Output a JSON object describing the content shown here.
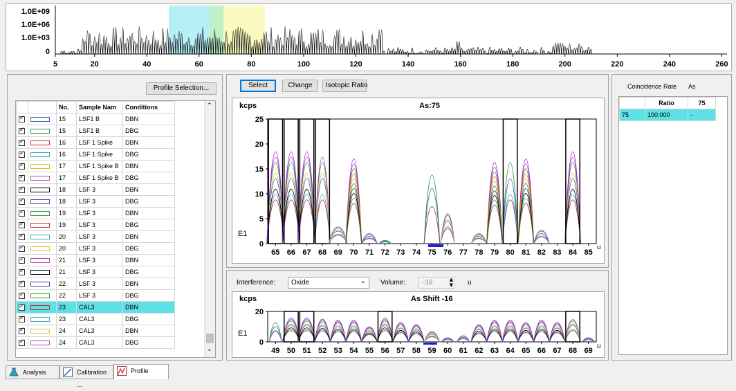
{
  "overview": {
    "y_ticks": [
      "1.0E+09",
      "1.0E+06",
      "1.0E+03",
      "0"
    ],
    "x_ticks": [
      "5",
      "20",
      "40",
      "60",
      "80",
      "100",
      "120",
      "140",
      "160",
      "180",
      "200",
      "220",
      "240",
      "260"
    ]
  },
  "left_panel": {
    "profile_selection_label": "Profile Selection...",
    "columns": [
      "No.",
      "Sample Nam",
      "Conditions"
    ],
    "rows": [
      {
        "no": "15",
        "sample": "LSF1 B",
        "cond": "DBN",
        "color": "#3c63c4",
        "selected": false
      },
      {
        "no": "15",
        "sample": "LSF1 B",
        "cond": "DBG",
        "color": "#2e9a3a",
        "selected": false
      },
      {
        "no": "16",
        "sample": "LSF 1 Spike",
        "cond": "DBN",
        "color": "#c43232",
        "selected": false
      },
      {
        "no": "16",
        "sample": "LSF 1 Spike",
        "cond": "DBG",
        "color": "#32aac8",
        "selected": false
      },
      {
        "no": "17",
        "sample": "LSF 1 Spike B",
        "cond": "DBN",
        "color": "#e0c030",
        "selected": false
      },
      {
        "no": "17",
        "sample": "LSF 1 Spike B",
        "cond": "DBG",
        "color": "#c040c0",
        "selected": false
      },
      {
        "no": "18",
        "sample": "LSF 3",
        "cond": "DBN",
        "color": "#000000",
        "selected": false
      },
      {
        "no": "18",
        "sample": "LSF 3",
        "cond": "DBG",
        "color": "#3c3cb4",
        "selected": false
      },
      {
        "no": "19",
        "sample": "LSF 3",
        "cond": "DBN",
        "color": "#2e9a3a",
        "selected": false
      },
      {
        "no": "19",
        "sample": "LSF 3",
        "cond": "DBG",
        "color": "#c43232",
        "selected": false
      },
      {
        "no": "20",
        "sample": "LSF 3",
        "cond": "DBN",
        "color": "#32aac8",
        "selected": false
      },
      {
        "no": "20",
        "sample": "LSF 3",
        "cond": "DBG",
        "color": "#e0c030",
        "selected": false
      },
      {
        "no": "21",
        "sample": "LSF 3",
        "cond": "DBN",
        "color": "#c040c0",
        "selected": false
      },
      {
        "no": "21",
        "sample": "LSF 3",
        "cond": "DBG",
        "color": "#000000",
        "selected": false
      },
      {
        "no": "22",
        "sample": "LSF 3",
        "cond": "DBN",
        "color": "#3c3cb4",
        "selected": false
      },
      {
        "no": "22",
        "sample": "LSF 3",
        "cond": "DBG",
        "color": "#2e9a3a",
        "selected": false
      },
      {
        "no": "23",
        "sample": "CAL3",
        "cond": "DBN",
        "color": "#c43232",
        "selected": true
      },
      {
        "no": "23",
        "sample": "CAL3",
        "cond": "DBG",
        "color": "#32aac8",
        "selected": false
      },
      {
        "no": "24",
        "sample": "CAL3",
        "cond": "DBN",
        "color": "#e0c030",
        "selected": false
      },
      {
        "no": "24",
        "sample": "CAL3",
        "cond": "DBG",
        "color": "#c040c0",
        "selected": false
      }
    ]
  },
  "toolbar": {
    "select_label": "Select",
    "change_label": "Change",
    "isotopic_ratio_label": "Isotopic Ratio"
  },
  "main_chart": {
    "unit": "kcps",
    "title": "As:75",
    "y_ticks": [
      "25",
      "20",
      "15",
      "10",
      "5",
      "0"
    ],
    "exponent_label": "E1",
    "x_ticks": [
      "65",
      "66",
      "67",
      "68",
      "69",
      "70",
      "71",
      "72",
      "73",
      "74",
      "75",
      "76",
      "77",
      "78",
      "79",
      "80",
      "81",
      "82",
      "83",
      "84",
      "85"
    ],
    "x_unit": "u"
  },
  "interference": {
    "label": "Interference:",
    "value": "Oxide",
    "volume_label": "Volume:",
    "volume_value": "-16",
    "unit": "u"
  },
  "shift_chart": {
    "unit": "kcps",
    "title": "As Shift -16",
    "y_ticks": [
      "20",
      "0"
    ],
    "exponent_label": "E1",
    "x_ticks": [
      "49",
      "50",
      "51",
      "52",
      "53",
      "54",
      "55",
      "56",
      "57",
      "58",
      "59",
      "60",
      "61",
      "62",
      "63",
      "64",
      "65",
      "66",
      "67",
      "68",
      "69"
    ],
    "x_unit": "u"
  },
  "right_panel": {
    "title": "Coincidence Rate",
    "element": "As",
    "headers": [
      "",
      "Ratio",
      "75"
    ],
    "row": [
      "75",
      "100.000",
      "-"
    ]
  },
  "tabs": [
    {
      "label": "Analysis",
      "icon": "flask-icon"
    },
    {
      "label": "Calibration ...",
      "icon": "calibration-curve-icon"
    },
    {
      "label": "Profile",
      "icon": "profile-chart-icon"
    }
  ]
}
